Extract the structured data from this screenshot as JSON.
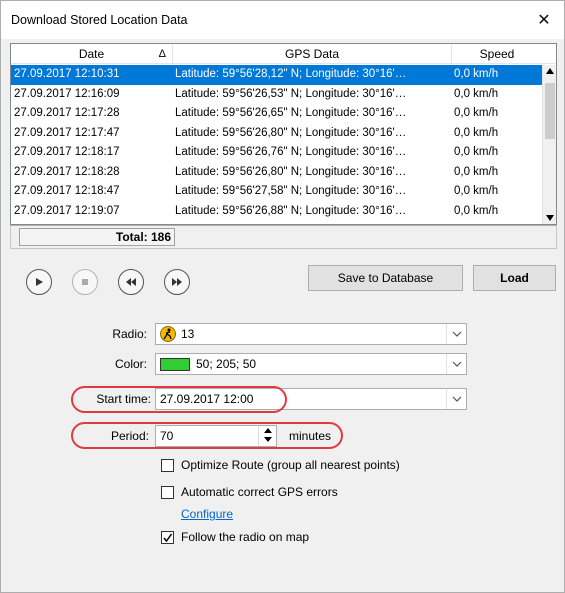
{
  "window": {
    "title": "Download Stored Location Data",
    "close_glyph": "✕"
  },
  "grid": {
    "columns": [
      {
        "label": "Date",
        "sort_glyph": "Δ"
      },
      {
        "label": "GPS Data"
      },
      {
        "label": "Speed"
      }
    ],
    "rows": [
      {
        "date": "27.09.2017 12:10:31",
        "gps": "Latitude: 59°56'28,12\" N; Longitude: 30°16'…",
        "speed": "0,0 km/h",
        "selected": true
      },
      {
        "date": "27.09.2017 12:16:09",
        "gps": "Latitude: 59°56'26,53\" N; Longitude: 30°16'…",
        "speed": "0,0 km/h"
      },
      {
        "date": "27.09.2017 12:17:28",
        "gps": "Latitude: 59°56'26,65\" N; Longitude: 30°16'…",
        "speed": "0,0 km/h"
      },
      {
        "date": "27.09.2017 12:17:47",
        "gps": "Latitude: 59°56'26,80\" N; Longitude: 30°16'…",
        "speed": "0,0 km/h"
      },
      {
        "date": "27.09.2017 12:18:17",
        "gps": "Latitude: 59°56'26,76\" N; Longitude: 30°16'…",
        "speed": "0,0 km/h"
      },
      {
        "date": "27.09.2017 12:18:28",
        "gps": "Latitude: 59°56'26,80\" N; Longitude: 30°16'…",
        "speed": "0,0 km/h"
      },
      {
        "date": "27.09.2017 12:18:47",
        "gps": "Latitude: 59°56'27,58\" N; Longitude: 30°16'…",
        "speed": "0,0 km/h"
      },
      {
        "date": "27.09.2017 12:19:07",
        "gps": "Latitude: 59°56'26,88\" N; Longitude: 30°16'…",
        "speed": "0,0 km/h"
      }
    ],
    "total": "Total: 186"
  },
  "toolbar": {
    "save_label": "Save to Database",
    "load_label": "Load"
  },
  "form": {
    "radio_label": "Radio:",
    "radio_value": "13",
    "color_label": "Color:",
    "color_value": "50; 205; 50",
    "color_hex": "#32cd32",
    "start_label": "Start time:",
    "start_value": "27.09.2017 12:00",
    "period_label": "Period:",
    "period_value": "70",
    "period_unit": "minutes",
    "optimize_label": "Optimize Route (group all nearest points)",
    "optimize_checked": false,
    "autocorrect_label": "Automatic correct GPS errors",
    "autocorrect_checked": false,
    "configure_link": "Configure",
    "follow_label": "Follow the radio on map",
    "follow_checked": true
  },
  "colors": {
    "selection": "#0078d7",
    "highlight_oval": "#e0393e",
    "link": "#0066cc"
  }
}
